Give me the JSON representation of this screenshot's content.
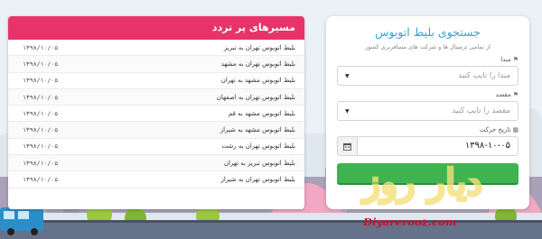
{
  "routes": {
    "title": "مسیرهای پر تردد",
    "items": [
      {
        "name": "بلیط اتوبوس تهران به تبریز",
        "date": "۱۳۹۸/۱۰/۰۵"
      },
      {
        "name": "بلیط اتوبوس تهران به مشهد",
        "date": "۱۳۹۸/۱۰/۰۵"
      },
      {
        "name": "بلیط اتوبوس مشهد به تهران",
        "date": "۱۳۹۸/۱۰/۰۵"
      },
      {
        "name": "بلیط اتوبوس تهران به اصفهان",
        "date": "۱۳۹۸/۱۰/۰۵"
      },
      {
        "name": "بلیط اتوبوس مشهد به قم",
        "date": "۱۳۹۸/۱۰/۰۵"
      },
      {
        "name": "بلیط اتوبوس مشهد به شیراز",
        "date": "۱۳۹۸/۱۰/۰۵"
      },
      {
        "name": "بلیط اتوبوس تهران به رشت",
        "date": "۱۳۹۸/۱۰/۰۵"
      },
      {
        "name": "بلیط اتوبوس تبریز به تهران",
        "date": "۱۳۹۸/۱۰/۰۵"
      },
      {
        "name": "بلیط اتوبوس تهران به شیراز",
        "date": "۱۳۹۸/۱۰/۰۵"
      }
    ]
  },
  "search": {
    "title": "جستجوی بلیط اتوبوس",
    "subtitle": "از تمامی ترمینال ها و شرکت های مسافربری کشور",
    "origin_label": "مبدا",
    "origin_placeholder": "مبدا را تایپ کنید",
    "destination_label": "مقصد",
    "destination_placeholder": "مقصد را تایپ کنید",
    "date_label": "تاریخ حرکت",
    "date_value": "۱۳۹۸-۱۰-۰۵"
  },
  "watermark": {
    "logo_text": "دیار روز",
    "url": "Diyarerooz.com"
  },
  "colors": {
    "accent_pink": "#e8336a",
    "title_blue": "#36a3d6",
    "button_green": "#3fb34f",
    "watermark_red": "#c8102e"
  },
  "icons": {
    "pin": "map-pin-icon",
    "calendar": "calendar-icon",
    "caret": "caret-down-icon"
  }
}
